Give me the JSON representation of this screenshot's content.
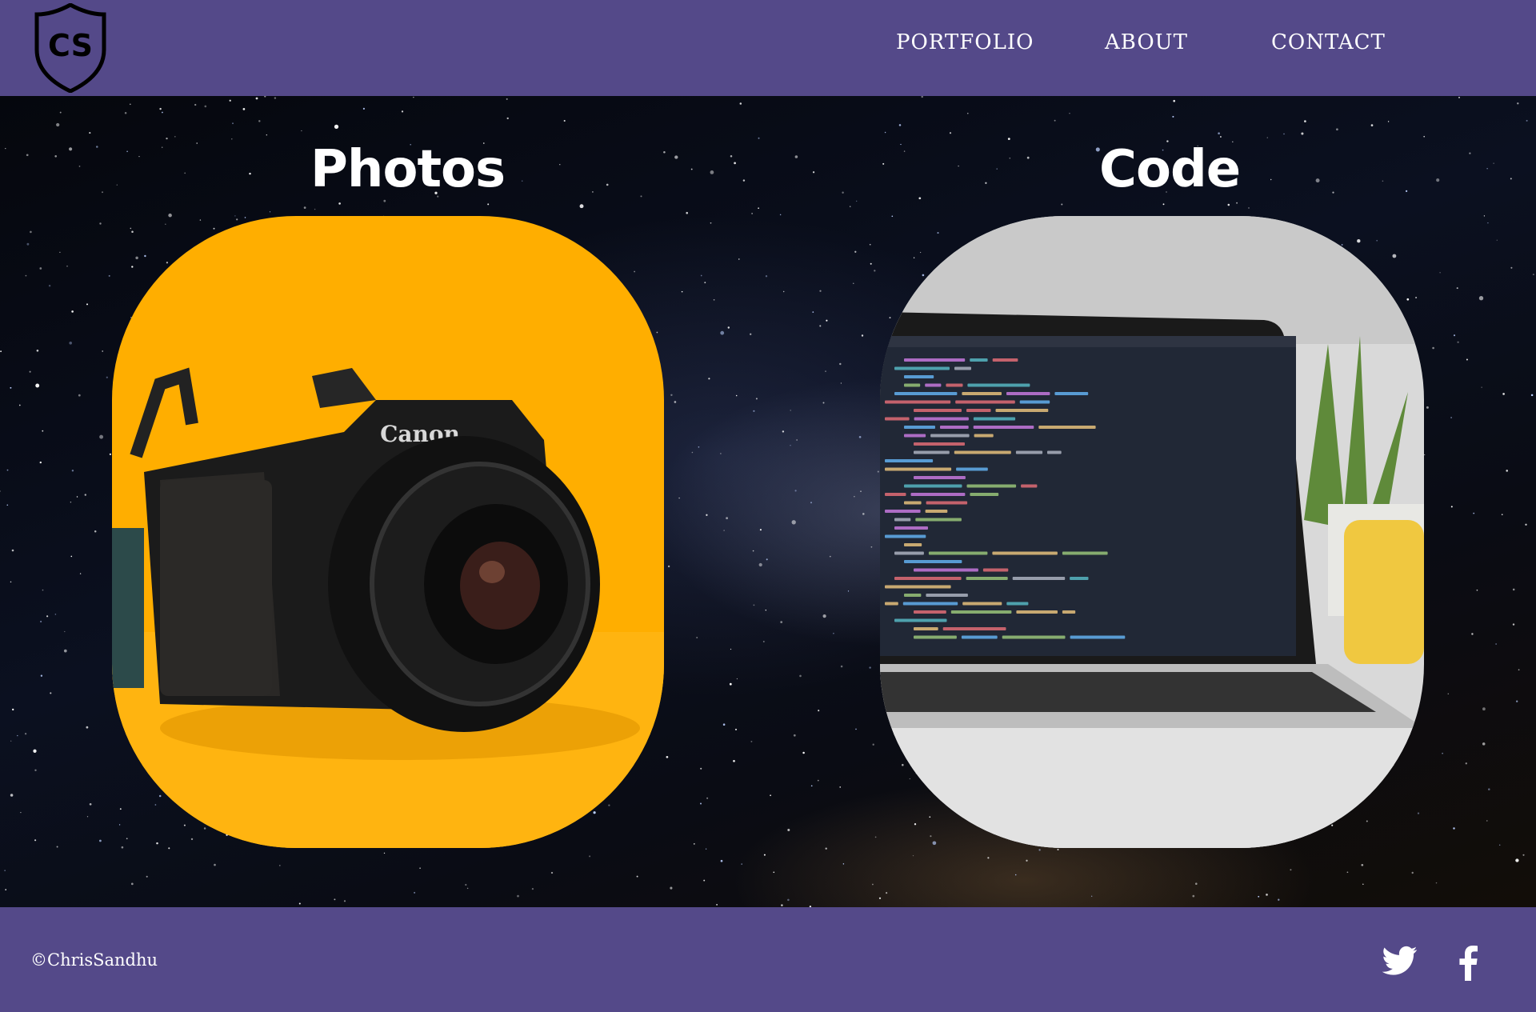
{
  "header": {
    "logo_text": "CS",
    "nav": [
      "PORTFOLIO",
      "ABOUT",
      "CONTACT"
    ]
  },
  "sections": [
    {
      "title": "Photos",
      "image": "camera-photo",
      "camera_brand": "Canon"
    },
    {
      "title": "Code",
      "image": "laptop-code-photo"
    }
  ],
  "footer": {
    "copyright": "©ChrisSandhu",
    "social": [
      "twitter-icon",
      "facebook-icon"
    ]
  },
  "colors": {
    "brand": "#544989",
    "photos_bg": "#FFAE00",
    "text": "#FFFFFF"
  }
}
